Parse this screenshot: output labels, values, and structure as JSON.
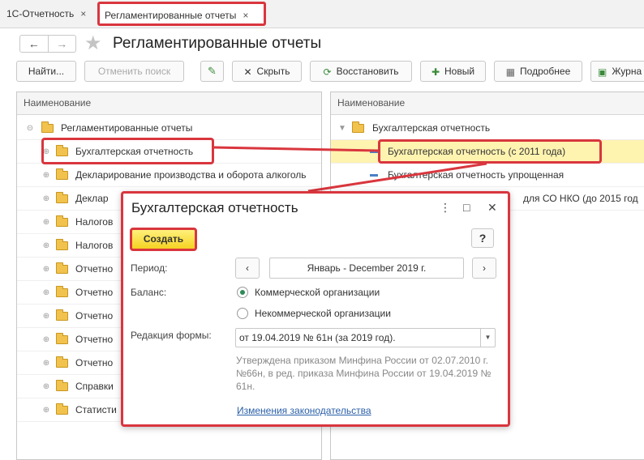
{
  "tabs": [
    {
      "label": "1С-Отчетность",
      "close": "×"
    },
    {
      "label": "Регламентированные отчеты",
      "close": "×"
    }
  ],
  "header": {
    "back_icon": "arrow-left-icon",
    "forward_icon": "arrow-right-icon",
    "star_icon": "star-icon",
    "title": "Регламентированные отчеты"
  },
  "toolbar": {
    "find_label": "Найти...",
    "cancel_search_label": "Отменить поиск",
    "hide_label": "Скрыть",
    "restore_label": "Восстановить",
    "new_label": "Новый",
    "details_label": "Подробнее",
    "journal_label": "Журна"
  },
  "left_panel": {
    "column_header": "Наименование",
    "root": "Регламентированные отчеты",
    "items": [
      "Бухгалтерская отчетность",
      "Декларирование производства и оборота алкоголь",
      "Деклар",
      "Налогов",
      "Налогов",
      "Отчетно",
      "Отчетно",
      "Отчетно",
      "Отчетно",
      "Отчетно",
      "Справки",
      "Статисти"
    ]
  },
  "right_panel": {
    "column_header": "Наименование",
    "group": "Бухгалтерская отчетность",
    "items": [
      "Бухгалтерская отчетность (с 2011 года)",
      "Бухгалтерская отчетность упрощенная",
      "для СО НКО (до 2015 год"
    ]
  },
  "dialog": {
    "title": "Бухгалтерская отчетность",
    "more_icon": "⋮",
    "maximize_icon": "□",
    "close_icon": "✕",
    "create_label": "Создать",
    "help_label": "?",
    "period_label": "Период:",
    "prev_label": "‹",
    "period_value": "Январь - December 2019 г.",
    "next_label": "›",
    "balance_label": "Баланс:",
    "radio_commercial": "Коммерческой организации",
    "radio_noncommercial": "Некоммерческой организации",
    "selected_balance": "commercial",
    "form_edition_label": "Редакция формы:",
    "form_edition_value": "от 19.04.2019 № 61н (за 2019 год).",
    "note": "Утверждена приказом Минфина России от 02.07.2010 г. №66н, в ред. приказа Минфина России от 19.04.2019 № 61н.",
    "law_link": "Изменения законодательства"
  },
  "colors": {
    "highlight_red": "#d9363e",
    "create_yellow": "#f5d323",
    "selected_row": "#fff3b0",
    "link_blue": "#2a5fa8"
  }
}
